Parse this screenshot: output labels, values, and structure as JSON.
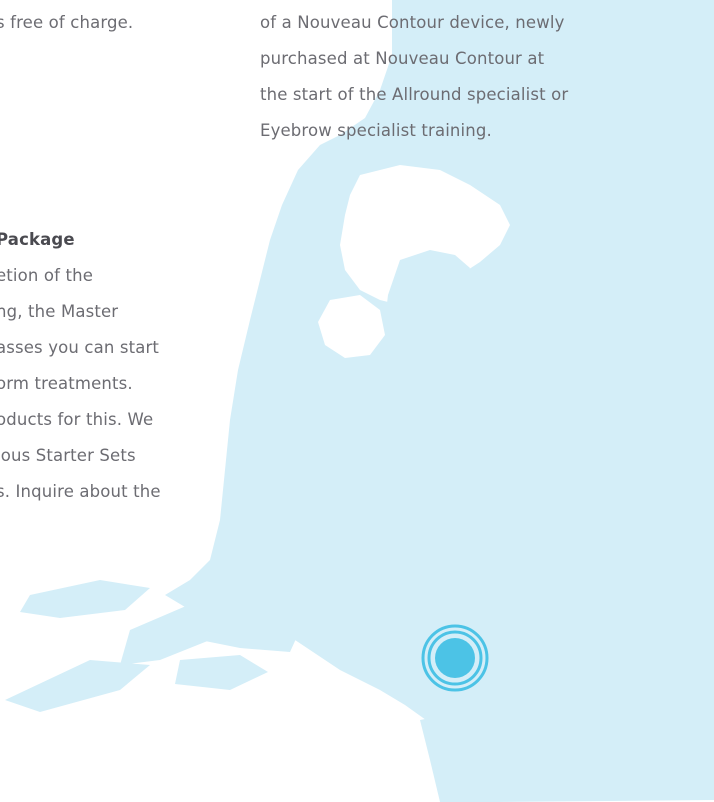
{
  "left_column": {
    "top_fragment": "s free of charge.",
    "package_heading": "Package",
    "package_lines": [
      "etion of the",
      "ng, the Master",
      "asses you can start",
      "orm treatments.",
      "oducts for this. We",
      "ious Starter Sets",
      "s. Inquire about the"
    ]
  },
  "right_column": {
    "lines": [
      "of a Nouveau Contour device, newly",
      "purchased at Nouveau Contour at",
      "the start of the Allround specialist or",
      "Eyebrow specialist training."
    ]
  },
  "map": {
    "land_color": "#d4eef8",
    "marker_color": "#4cc3e6",
    "marker_icon": "location-target-icon"
  }
}
